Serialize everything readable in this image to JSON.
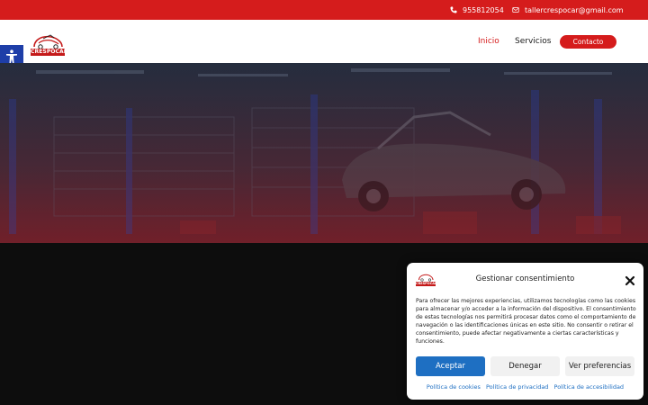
{
  "topbar": {
    "phone": "955812054",
    "email": "tallercrespocar@gmail.com",
    "phone_icon": "phone-icon",
    "email_icon": "envelope-icon"
  },
  "header": {
    "logo_text": "CRESPOCAR",
    "nav": [
      {
        "label": "Inicio",
        "active": true
      },
      {
        "label": "Servicios",
        "active": false
      }
    ],
    "contact_button": "Contacto"
  },
  "accessibility": {
    "icon": "accessibility-icon"
  },
  "consent": {
    "title": "Gestionar consentimiento",
    "logo_text": "CRESPOCAR",
    "body": "Para ofrecer las mejores experiencias, utilizamos tecnologías como las cookies para almacenar y/o acceder a la información del dispositivo. El consentimiento de estas tecnologías nos permitirá procesar datos como el comportamiento de navegación o las identificaciones únicas en este sitio. No consentir o retirar el consentimiento, puede afectar negativamente a ciertas características y funciones.",
    "buttons": {
      "accept": "Aceptar",
      "deny": "Denegar",
      "preferences": "Ver preferencias"
    },
    "links": [
      "Política de cookies",
      "Política de privacidad",
      "Política de accesibilidad"
    ]
  },
  "colors": {
    "brand_red": "#d51c1c",
    "accept_blue": "#1e6fc2",
    "accessibility_blue": "#1e3ea8"
  }
}
